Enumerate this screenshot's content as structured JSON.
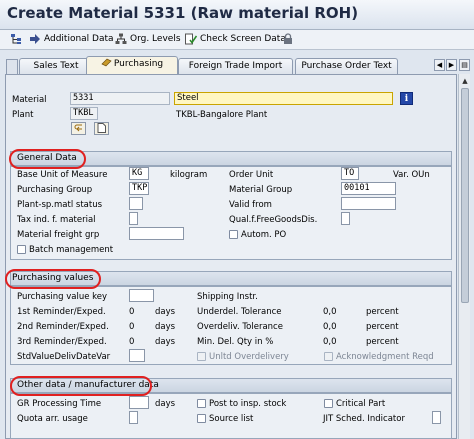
{
  "window": {
    "title": "Create Material 5331 (Raw material ROH)"
  },
  "toolbar": {
    "additional_data": "Additional Data",
    "org_levels": "Org. Levels",
    "check_screen_data": "Check Screen Data"
  },
  "tabs": [
    {
      "label": "Sales Text"
    },
    {
      "label": "Purchasing"
    },
    {
      "label": "Foreign Trade Import"
    },
    {
      "label": "Purchase Order Text"
    }
  ],
  "header": {
    "material_label": "Material",
    "material_value": "5331",
    "material_desc": "Steel",
    "plant_label": "Plant",
    "plant_value": "TKBL",
    "plant_desc": "TKBL-Bangalore Plant",
    "info_icon": "i"
  },
  "general_data": {
    "title": "General Data",
    "base_uom_label": "Base Unit of Measure",
    "base_uom_value": "KG",
    "base_uom_text": "kilogram",
    "order_unit_label": "Order Unit",
    "order_unit_value": "TO",
    "var_oun_label": "Var. OUn",
    "purch_group_label": "Purchasing Group",
    "purch_group_value": "TKP",
    "material_group_label": "Material Group",
    "material_group_value": "00101",
    "plant_sp_status_label": "Plant-sp.matl status",
    "valid_from_label": "Valid from",
    "tax_ind_label": "Tax ind. f. material",
    "qual_free_goods_label": "Qual.f.FreeGoodsDis.",
    "freight_grp_label": "Material freight grp",
    "autom_po_label": "Autom. PO",
    "batch_mgmt_label": "Batch management"
  },
  "purchasing_values": {
    "title": "Purchasing values",
    "pvk_label": "Purchasing value key",
    "shipping_instr_label": "Shipping Instr.",
    "rem1_label": "1st Reminder/Exped.",
    "rem1_value": "0",
    "rem2_label": "2nd Reminder/Exped.",
    "rem2_value": "0",
    "rem3_label": "3rd Reminder/Exped.",
    "rem3_value": "0",
    "days": "days",
    "underdel_label": "Underdel. Tolerance",
    "underdel_value": "0,0",
    "overdel_label": "Overdeliv. Tolerance",
    "overdel_value": "0,0",
    "min_del_label": "Min. Del. Qty in %",
    "min_del_value": "0,0",
    "percent": "percent",
    "std_value_label": "StdValueDelivDateVar",
    "unltd_overdelivery_label": "Unltd Overdelivery",
    "ack_reqd_label": "Acknowledgment Reqd"
  },
  "other_data": {
    "title": "Other data / manufacturer data",
    "gr_proc_label": "GR Processing Time",
    "gr_proc_unit": "days",
    "post_insp_label": "Post to insp. stock",
    "critical_part_label": "Critical Part",
    "quota_label": "Quota arr. usage",
    "source_list_label": "Source list",
    "jit_label": "JIT Sched. Indicator"
  },
  "colors": {
    "highlight_oval": "#e02020",
    "required_field": "#fff7c2",
    "info_button": "#2447a8"
  }
}
